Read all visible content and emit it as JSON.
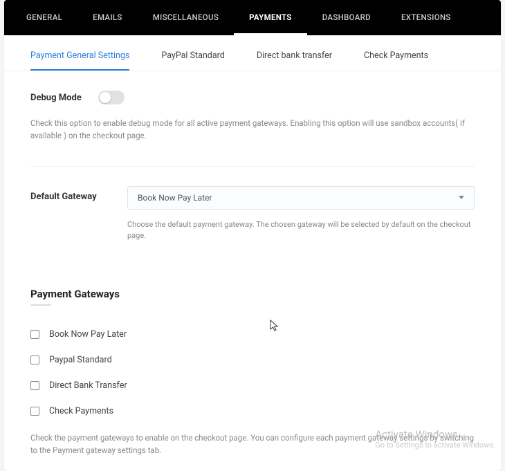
{
  "topnav": {
    "items": [
      {
        "label": "GENERAL"
      },
      {
        "label": "EMAILS"
      },
      {
        "label": "MISCELLANEOUS"
      },
      {
        "label": "PAYMENTS"
      },
      {
        "label": "DASHBOARD"
      },
      {
        "label": "EXTENSIONS"
      }
    ],
    "active_index": 3
  },
  "subnav": {
    "items": [
      {
        "label": "Payment General Settings"
      },
      {
        "label": "PayPal Standard"
      },
      {
        "label": "Direct bank transfer"
      },
      {
        "label": "Check Payments"
      }
    ],
    "active_index": 0
  },
  "debug": {
    "label": "Debug Mode",
    "enabled": false,
    "help": "Check this option to enable debug mode for all active payment gateways. Enabling this option will use sandbox accounts( if available ) on the checkout page."
  },
  "default_gateway": {
    "label": "Default Gateway",
    "selected": "Book Now Pay Later",
    "help": "Choose the default payment gateway. The chosen gateway will be selected by default on the checkout page."
  },
  "gateways": {
    "title": "Payment Gateways",
    "items": [
      {
        "label": "Book Now Pay Later",
        "checked": false
      },
      {
        "label": "Paypal Standard",
        "checked": false
      },
      {
        "label": "Direct Bank Transfer",
        "checked": false
      },
      {
        "label": "Check Payments",
        "checked": false
      }
    ],
    "help": "Check the payment gateways to enable on the checkout page. You can configure each payment gateway settings by switching to the Payment gateway settings tab."
  },
  "watermark": {
    "line1": "Activate Windows",
    "line2": "Go to Settings to activate Windows."
  }
}
